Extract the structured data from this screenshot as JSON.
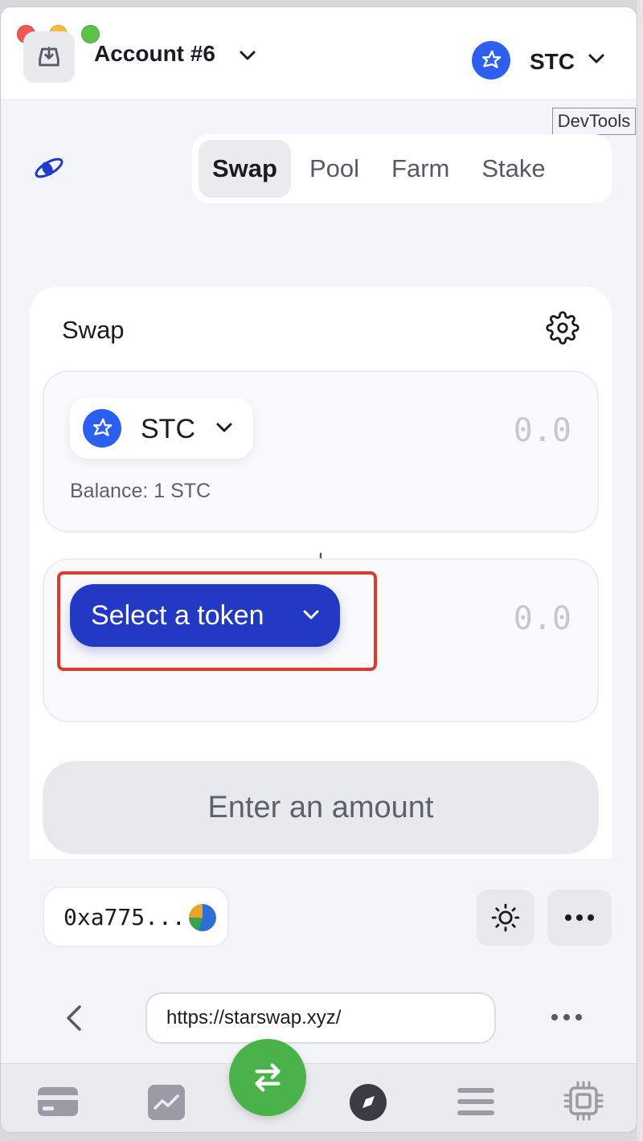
{
  "header": {
    "account_title": "Account #6",
    "network_label": "STC"
  },
  "devtools_label": "DevTools",
  "nav": {
    "tabs": [
      {
        "label": "Swap",
        "active": true
      },
      {
        "label": "Pool",
        "active": false
      },
      {
        "label": "Farm",
        "active": false
      },
      {
        "label": "Stake",
        "active": false
      }
    ]
  },
  "swap": {
    "title": "Swap",
    "from": {
      "token_symbol": "STC",
      "amount_placeholder": "0.0",
      "balance_text": "Balance: 1 STC"
    },
    "to": {
      "select_label": "Select a token",
      "amount_placeholder": "0.0"
    },
    "submit_label": "Enter an amount"
  },
  "wallet": {
    "address_short": "0xa775..."
  },
  "browser": {
    "url": "https://starswap.xyz/"
  },
  "colors": {
    "accent": "#2239c3",
    "stc_blue": "#2d5ff0",
    "fab_green": "#49b34a",
    "highlight_red": "#e0382b"
  },
  "icons": {
    "import": "download-tray-icon",
    "network": "stc-rocket-icon",
    "settings": "gear-icon",
    "theme": "sun-icon",
    "more": "ellipsis-icon",
    "back": "chevron-left-icon",
    "fab": "swap-arrows-icon",
    "bottom_nav": [
      "card-icon",
      "chart-icon",
      "compass-icon",
      "menu-icon",
      "chip-icon"
    ]
  }
}
